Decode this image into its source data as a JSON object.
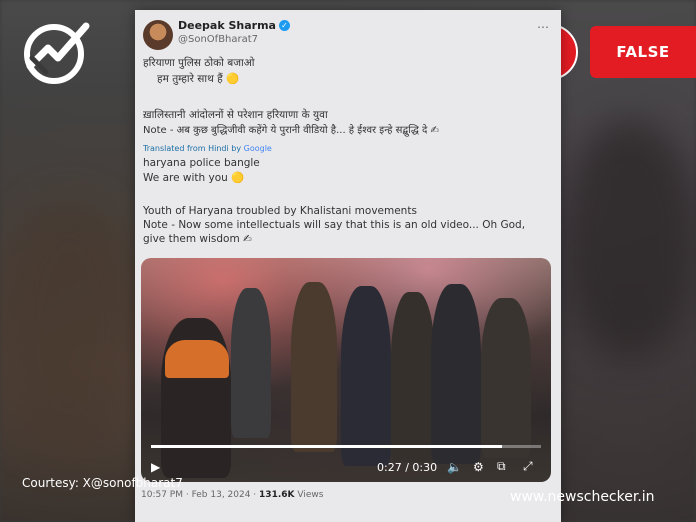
{
  "post": {
    "display_name": "Deepak Sharma",
    "handle": "@SonOfBharat7",
    "more_icon": "⋯",
    "hindi_line1": "हरियाणा पुलिस ठोको बजाओ",
    "hindi_line2": "हम तुम्हारे साथ हैं 🟡",
    "hindi_line3": "ख़ालिस्तानी आंदोलनों से परेशान हरियाणा के युवा",
    "hindi_line4": "Note - अब कुछ बुद्धिजीवी कहेंगे ये पुरानी वीडियो है... हे ईश्वर इन्हे सद्बुद्धि दे ✍",
    "translated_label": "Translated from Hindi by",
    "translated_brand": "Google",
    "en_line1": "haryana police bangle",
    "en_line2": "We are with you 🟡",
    "en_line3": "Youth of Haryana troubled by Khalistani movements",
    "en_line4": "Note - Now some intellectuals will say that this is an old video... Oh God,",
    "en_line5": "give them wisdom ✍",
    "timestamp": "10:57 PM · Feb 13, 2024 ·",
    "views_count": "131.6K",
    "views_label": "Views"
  },
  "video": {
    "current_time": "0:27",
    "duration": "0:30",
    "time_separator": " / ",
    "progress": 0.9
  },
  "verdict": {
    "icon": "!",
    "label": "FALSE",
    "color": "#e31c23"
  },
  "footer": {
    "courtesy": "Courtesy: X@sonofbharat7",
    "site": "www.newschecker.in"
  }
}
